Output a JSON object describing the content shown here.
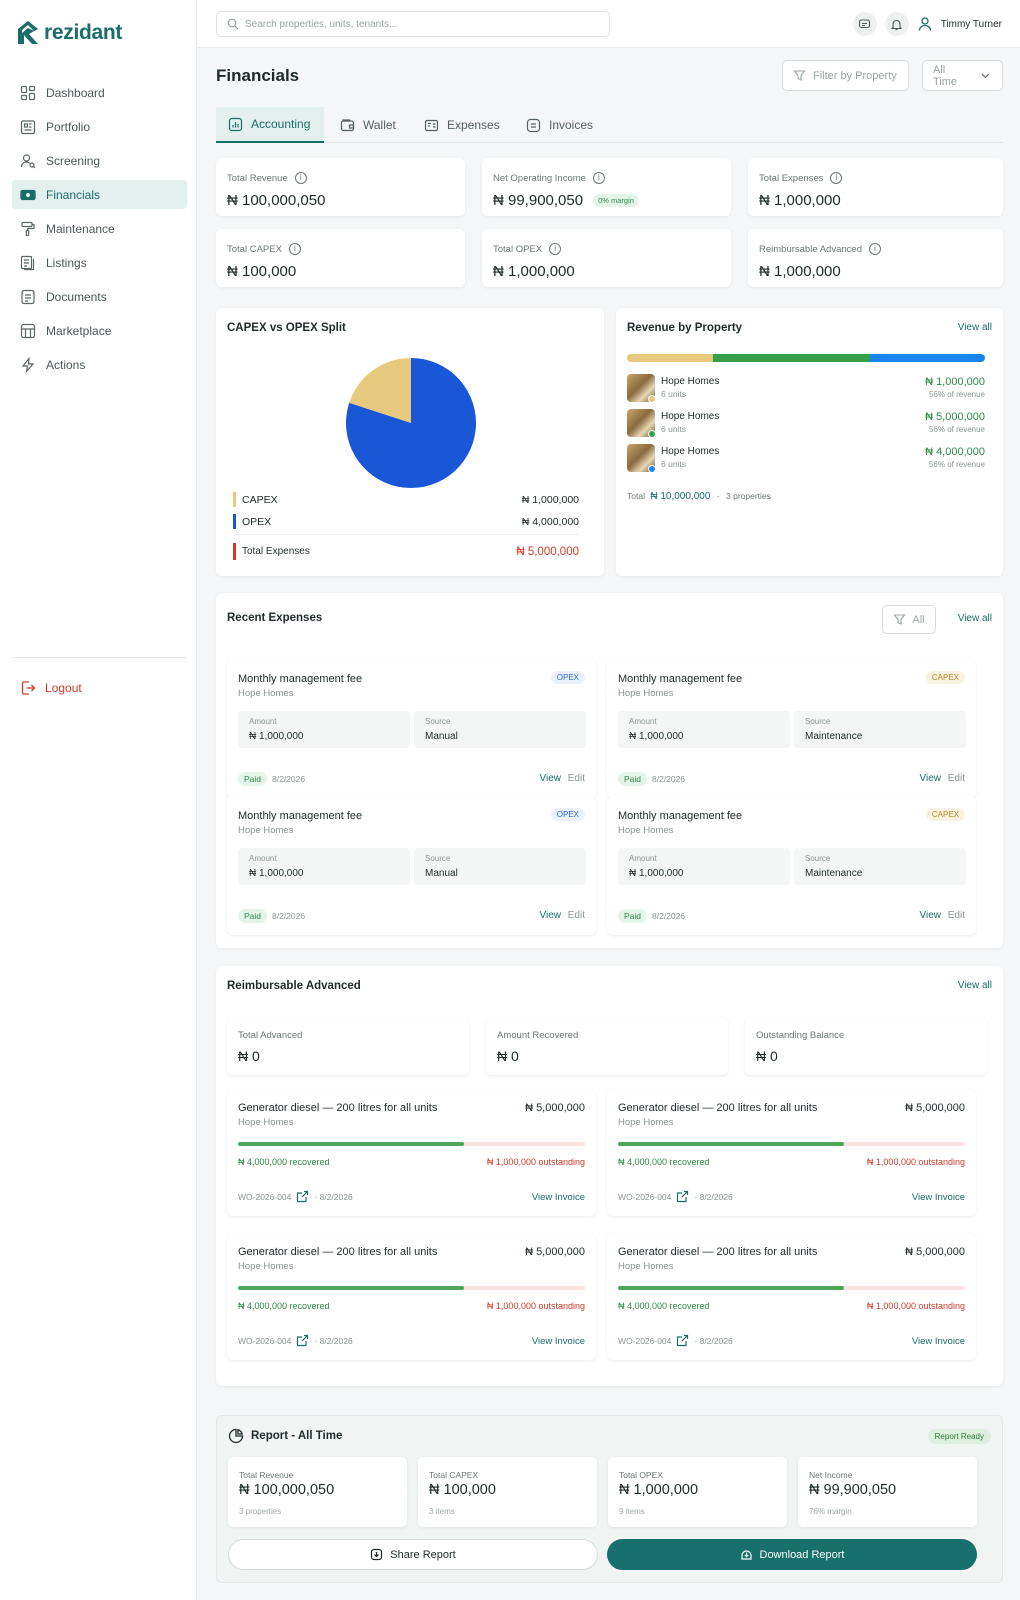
{
  "brand": {
    "name": "rezidant",
    "color": "#1a6e6a"
  },
  "sidebar": {
    "items": [
      {
        "label": "Dashboard",
        "icon": "dashboard-icon"
      },
      {
        "label": "Portfolio",
        "icon": "portfolio-icon"
      },
      {
        "label": "Screening",
        "icon": "screening-icon"
      },
      {
        "label": "Financials",
        "icon": "financials-icon",
        "active": true
      },
      {
        "label": "Maintenance",
        "icon": "maintenance-icon"
      },
      {
        "label": "Listings",
        "icon": "listings-icon"
      },
      {
        "label": "Documents",
        "icon": "documents-icon"
      },
      {
        "label": "Marketplace",
        "icon": "marketplace-icon"
      },
      {
        "label": "Actions",
        "icon": "actions-icon"
      }
    ],
    "logout": "Logout"
  },
  "topbar": {
    "search_placeholder": "Search properties, units, tenants...",
    "user": "Timmy Turner"
  },
  "page": {
    "title": "Financials",
    "filter_property": "Filter by Property",
    "time_filter": "All Time"
  },
  "tabs": [
    {
      "label": "Accounting"
    },
    {
      "label": "Wallet"
    },
    {
      "label": "Expenses"
    },
    {
      "label": "Invoices"
    }
  ],
  "stats": [
    {
      "label": "Total Revenue",
      "value": "₦ 100,000,050"
    },
    {
      "label": "Net Operating Income",
      "value": "₦ 99,900,050",
      "badge": "0% margin"
    },
    {
      "label": "Total Expenses",
      "value": "₦ 1,000,000"
    },
    {
      "label": "Total CAPEX",
      "value": "₦ 100,000"
    },
    {
      "label": "Total OPEX",
      "value": "₦ 1,000,000"
    },
    {
      "label": "Reimbursable Advanced",
      "value": "₦ 1,000,000"
    }
  ],
  "split": {
    "title": "CAPEX vs OPEX Split",
    "chart_data": {
      "type": "pie",
      "slices": [
        {
          "label": "CAPEX",
          "value": 1000000,
          "color": "#e6c97c"
        },
        {
          "label": "OPEX",
          "value": 4000000,
          "color": "#1a57d6"
        }
      ]
    },
    "rows": [
      {
        "label": "CAPEX",
        "value": "₦ 1,000,000",
        "color": "#e6c97c"
      },
      {
        "label": "OPEX",
        "value": "₦ 4,000,000",
        "color": "#1a57d6"
      }
    ],
    "total": {
      "label": "Total Expenses",
      "value": "₦ 5,000,000",
      "color": "#d43a2a"
    }
  },
  "revenue": {
    "title": "Revenue by Property",
    "view_all": "View all",
    "bar": [
      {
        "share": 0.24,
        "color": "#e6c97c"
      },
      {
        "share": 0.44,
        "color": "#34a04a"
      },
      {
        "share": 0.32,
        "color": "#1a85f0"
      }
    ],
    "properties": [
      {
        "name": "Hope Homes",
        "units": "6 units",
        "amount": "₦ 1,000,000",
        "pct": "56% of revenue",
        "dot": "#e6c97c"
      },
      {
        "name": "Hope Homes",
        "units": "6 units",
        "amount": "₦ 5,000,000",
        "pct": "56% of revenue",
        "dot": "#34a04a"
      },
      {
        "name": "Hope Homes",
        "units": "6 units",
        "amount": "₦ 4,000,000",
        "pct": "56% of revenue",
        "dot": "#1a85f0"
      }
    ],
    "total_label": "Total",
    "total_value": "₦ 10,000,000",
    "total_props": "3 properties"
  },
  "expenses": {
    "title": "Recent Expenses",
    "filter": "All",
    "view_all": "View all",
    "items": [
      {
        "title": "Monthly management fee",
        "property": "Hope Homes",
        "tag": "OPEX",
        "amount_label": "Amount",
        "amount": "₦ 1,000,000",
        "source_label": "Source",
        "source": "Manual",
        "status": "Paid",
        "date": "8/2/2026",
        "view": "View",
        "edit": "Edit"
      },
      {
        "title": "Monthly management fee",
        "property": "Hope Homes",
        "tag": "CAPEX",
        "amount_label": "Amount",
        "amount": "₦ 1,000,000",
        "source_label": "Source",
        "source": "Maintenance",
        "status": "Paid",
        "date": "8/2/2026",
        "view": "View",
        "edit": "Edit"
      },
      {
        "title": "Monthly management fee",
        "property": "Hope Homes",
        "tag": "OPEX",
        "amount_label": "Amount",
        "amount": "₦ 1,000,000",
        "source_label": "Source",
        "source": "Manual",
        "status": "Paid",
        "date": "8/2/2026",
        "view": "View",
        "edit": "Edit"
      },
      {
        "title": "Monthly management fee",
        "property": "Hope Homes",
        "tag": "CAPEX",
        "amount_label": "Amount",
        "amount": "₦ 1,000,000",
        "source_label": "Source",
        "source": "Maintenance",
        "status": "Paid",
        "date": "8/2/2026",
        "view": "View",
        "edit": "Edit"
      }
    ]
  },
  "reimb": {
    "title": "Reimbursable Advanced",
    "view_all": "View all",
    "summary": [
      {
        "label": "Total Advanced",
        "value": "₦ 0"
      },
      {
        "label": "Amount Recovered",
        "value": "₦ 0"
      },
      {
        "label": "Outstanding Balance",
        "value": "₦ 0"
      }
    ],
    "items": [
      {
        "title": "Generator diesel — 200 litres for all units",
        "property": "Hope Homes",
        "amount": "₦ 5,000,000",
        "recovered": "₦ 4,000,000 recovered",
        "outstanding": "₦ 1,000,000 outstanding",
        "progress": 0.65,
        "wo": "WO-2026-004",
        "date": "8/2/2026",
        "link": "View Invoice"
      },
      {
        "title": "Generator diesel — 200 litres for all units",
        "property": "Hope Homes",
        "amount": "₦ 5,000,000",
        "recovered": "₦ 4,000,000 recovered",
        "outstanding": "₦ 1,000,000 outstanding",
        "progress": 0.65,
        "wo": "WO-2026-004",
        "date": "8/2/2026",
        "link": "View Invoice"
      },
      {
        "title": "Generator diesel — 200 litres for all units",
        "property": "Hope Homes",
        "amount": "₦ 5,000,000",
        "recovered": "₦ 4,000,000 recovered",
        "outstanding": "₦ 1,000,000 outstanding",
        "progress": 0.65,
        "wo": "WO-2026-004",
        "date": "8/2/2026",
        "link": "View Invoice"
      },
      {
        "title": "Generator diesel — 200 litres for all units",
        "property": "Hope Homes",
        "amount": "₦ 5,000,000",
        "recovered": "₦ 4,000,000 recovered",
        "outstanding": "₦ 1,000,000 outstanding",
        "progress": 0.65,
        "wo": "WO-2026-004",
        "date": "8/2/2026",
        "link": "View Invoice"
      }
    ]
  },
  "report": {
    "title": "Report - All Time",
    "badge": "Report Ready",
    "boxes": [
      {
        "label": "Total Revenue",
        "value": "₦ 100,000,050",
        "sub": "3 properties"
      },
      {
        "label": "Total CAPEX",
        "value": "₦ 100,000",
        "sub": "3 items"
      },
      {
        "label": "Total OPEX",
        "value": "₦ 1,000,000",
        "sub": "9 items"
      },
      {
        "label": "Net Income",
        "value": "₦ 99,900,050",
        "sub": "76% margin"
      }
    ],
    "share": "Share Report",
    "download": "Download Report"
  }
}
